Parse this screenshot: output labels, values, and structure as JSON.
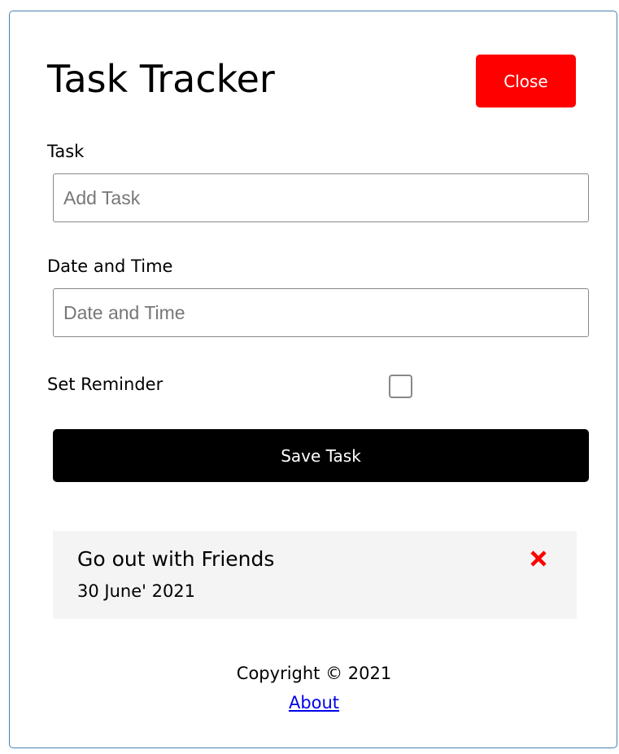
{
  "header": {
    "title": "Task Tracker",
    "close_label": "Close",
    "close_color": "#ff0000"
  },
  "form": {
    "task_label": "Task",
    "task_placeholder": "Add Task",
    "task_value": "",
    "datetime_label": "Date and Time",
    "datetime_placeholder": "Date and Time",
    "datetime_value": "",
    "reminder_label": "Set Reminder",
    "reminder_checked": false,
    "save_label": "Save Task"
  },
  "tasks": [
    {
      "title": "Go out with Friends",
      "date": "30 June' 2021",
      "delete_icon": "times-icon",
      "delete_color": "#ff0000"
    }
  ],
  "footer": {
    "copyright": "Copyright © 2021",
    "about_label": "About"
  }
}
